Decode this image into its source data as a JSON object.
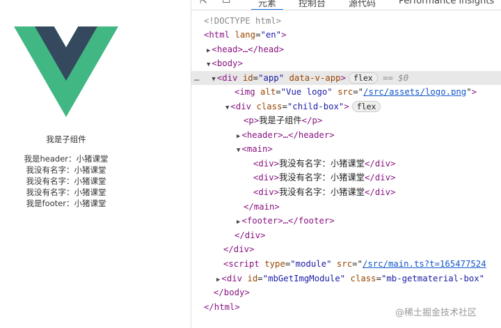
{
  "app": {
    "child_title": "我是子组件",
    "items": [
      "我是header：小猪课堂",
      "我没有名字：小猪课堂",
      "我没有名字：小猪课堂",
      "我没有名字：小猪课堂",
      "我是footer：小猪课堂"
    ]
  },
  "devtools": {
    "tabs": [
      "元素",
      "控制台",
      "源代码",
      "Performance insights"
    ],
    "lines": {
      "doctype": "<!DOCTYPE html>",
      "html_open": "<html",
      "lang_attr": "lang",
      "lang_val": "\"en\"",
      "head": "<head>…</head>",
      "body_open": "<body>",
      "app_div": "<div",
      "app_id": "id",
      "app_id_val": "\"app\"",
      "app_attr": "data-v-app",
      "flex": "flex",
      "sel_marker": "== $0",
      "dots": "…",
      "img_tag": "<img",
      "img_alt": "alt",
      "img_alt_val": "\"Vue logo\"",
      "img_src": "src",
      "img_src_val": "/src/assets/logo.png",
      "child_div": "<div",
      "child_class": "class",
      "child_class_val": "\"child-box\"",
      "p_open": "<p>",
      "p_text": "我是子组件",
      "p_close": "</p>",
      "header": "<header>…</header>",
      "main_open": "<main>",
      "div_open": "<div>",
      "div_text": "我没有名字：小猪课堂",
      "div_close": "</div>",
      "main_close": "</main>",
      "footer": "<footer>…</footer>",
      "div_end": "</div>",
      "script_tag": "<script",
      "script_type": "type",
      "script_type_val": "\"module\"",
      "script_src": "src",
      "script_src_val": "/src/main.ts?t=165477524",
      "mb_div": "<div",
      "mb_id": "id",
      "mb_id_val": "\"mbGetImgModule\"",
      "mb_class": "class",
      "mb_class_val": "\"mb-getmaterial-box\"",
      "body_close": "</body>",
      "html_close": "</html>"
    }
  },
  "watermark": "@稀土掘金技术社区"
}
